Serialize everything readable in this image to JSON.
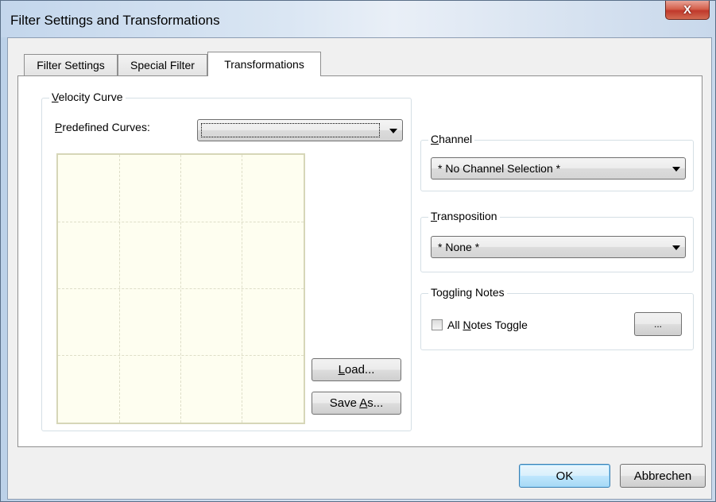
{
  "window": {
    "title": "Filter Settings and Transformations",
    "close_glyph": "X"
  },
  "tabs": [
    {
      "label": "Filter Settings",
      "active": false
    },
    {
      "label": "Special Filter",
      "active": false
    },
    {
      "label": "Transformations",
      "active": true
    }
  ],
  "velocity_curve": {
    "group_label_accel": "V",
    "group_label_rest": "elocity Curve",
    "predefined_label_accel": "P",
    "predefined_label_rest": "redefined Curves:",
    "predefined_value": "",
    "load_button_accel": "L",
    "load_button_rest": "oad...",
    "save_button_pre": "Save ",
    "save_button_accel": "A",
    "save_button_rest": "s..."
  },
  "channel": {
    "group_label_accel": "C",
    "group_label_rest": "hannel",
    "value": "* No Channel Selection *"
  },
  "transposition": {
    "group_label_accel": "T",
    "group_label_rest": "ransposition",
    "value": "* None *"
  },
  "toggling_notes": {
    "group_label": "Toggling Notes",
    "checkbox_pre": "All ",
    "checkbox_accel": "N",
    "checkbox_rest": "otes Toggle",
    "checked": false,
    "browse_button": "..."
  },
  "footer": {
    "ok_label": "OK",
    "cancel_label": "Abbrechen"
  },
  "colors": {
    "accent_default_button": "#3c7fb1",
    "close_button": "#c0392b",
    "curve_background": "#fefef0"
  }
}
